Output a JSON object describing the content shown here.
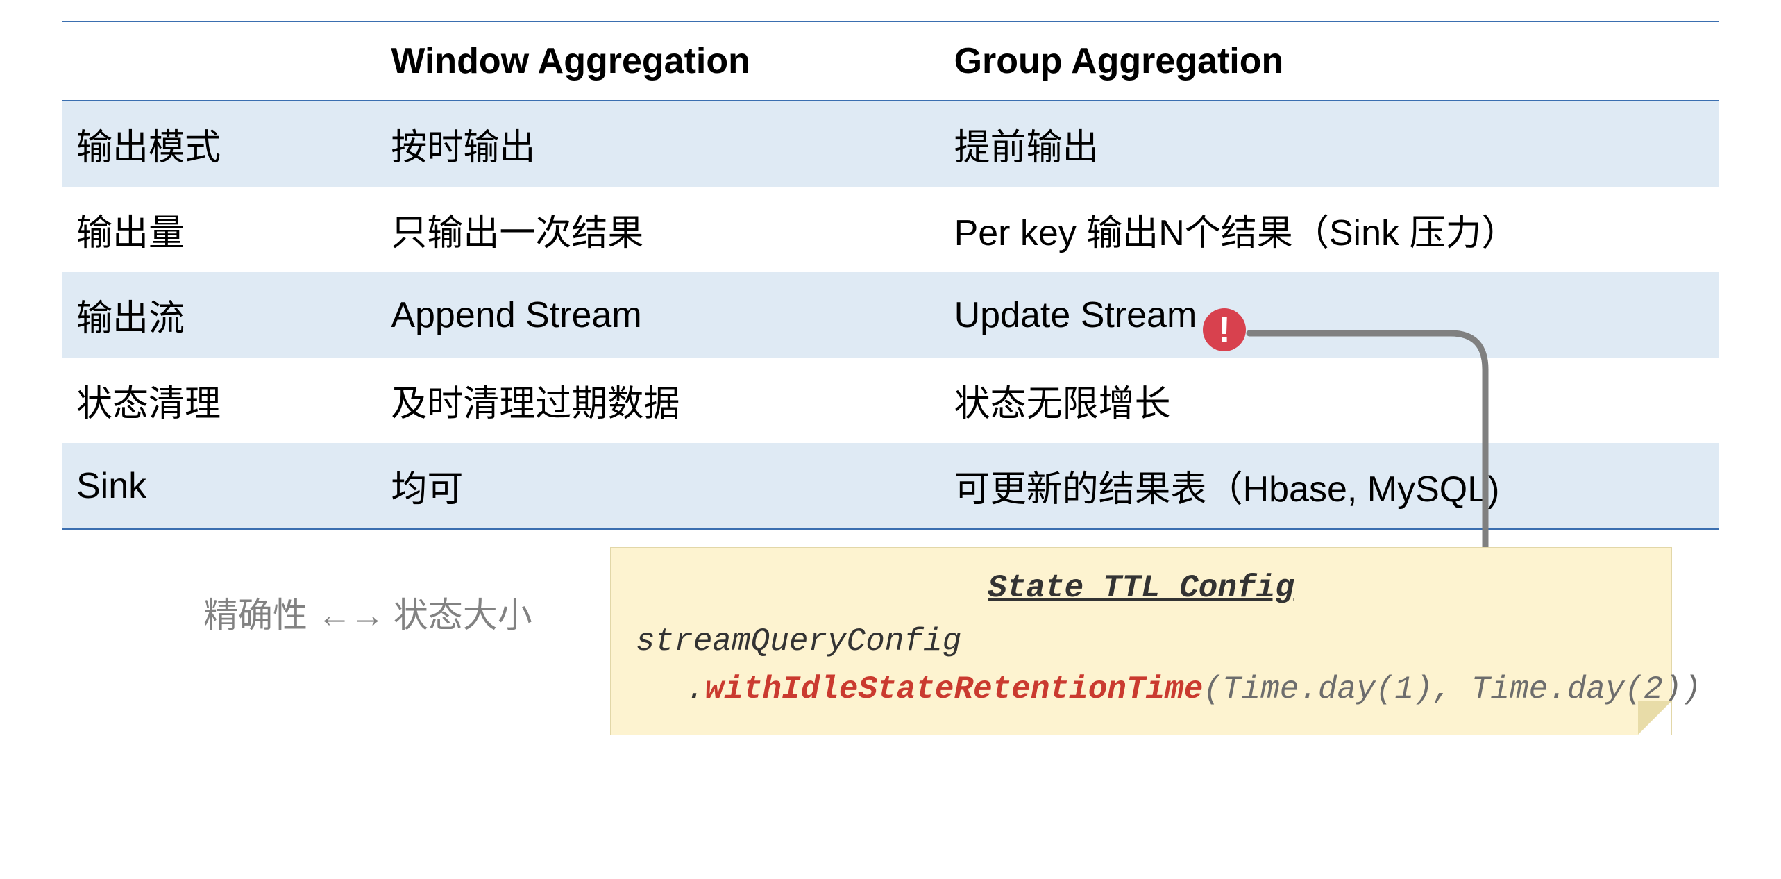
{
  "table": {
    "headers": [
      "",
      "Window Aggregation",
      "Group Aggregation"
    ],
    "rows": [
      {
        "label": "输出模式",
        "win": "按时输出",
        "grp": "提前输出"
      },
      {
        "label": "输出量",
        "win": "只输出一次结果",
        "grp": "Per key 输出N个结果（Sink 压力）"
      },
      {
        "label": "输出流",
        "win": "Append Stream",
        "grp": "Update Stream"
      },
      {
        "label": "状态清理",
        "win": "及时清理过期数据",
        "grp": "状态无限增长"
      },
      {
        "label": "Sink",
        "win": "均可",
        "grp": "可更新的结果表（Hbase, MySQL)"
      }
    ]
  },
  "alert_glyph": "!",
  "tradeoff": {
    "left": "精确性",
    "arrow": "←→",
    "right": "状态大小"
  },
  "code": {
    "title": "State TTL Config",
    "line1": "streamQueryConfig",
    "dot": ".",
    "method": "withIdleStateRetentionTime",
    "args": "(Time.day(1), Time.day(2))"
  }
}
